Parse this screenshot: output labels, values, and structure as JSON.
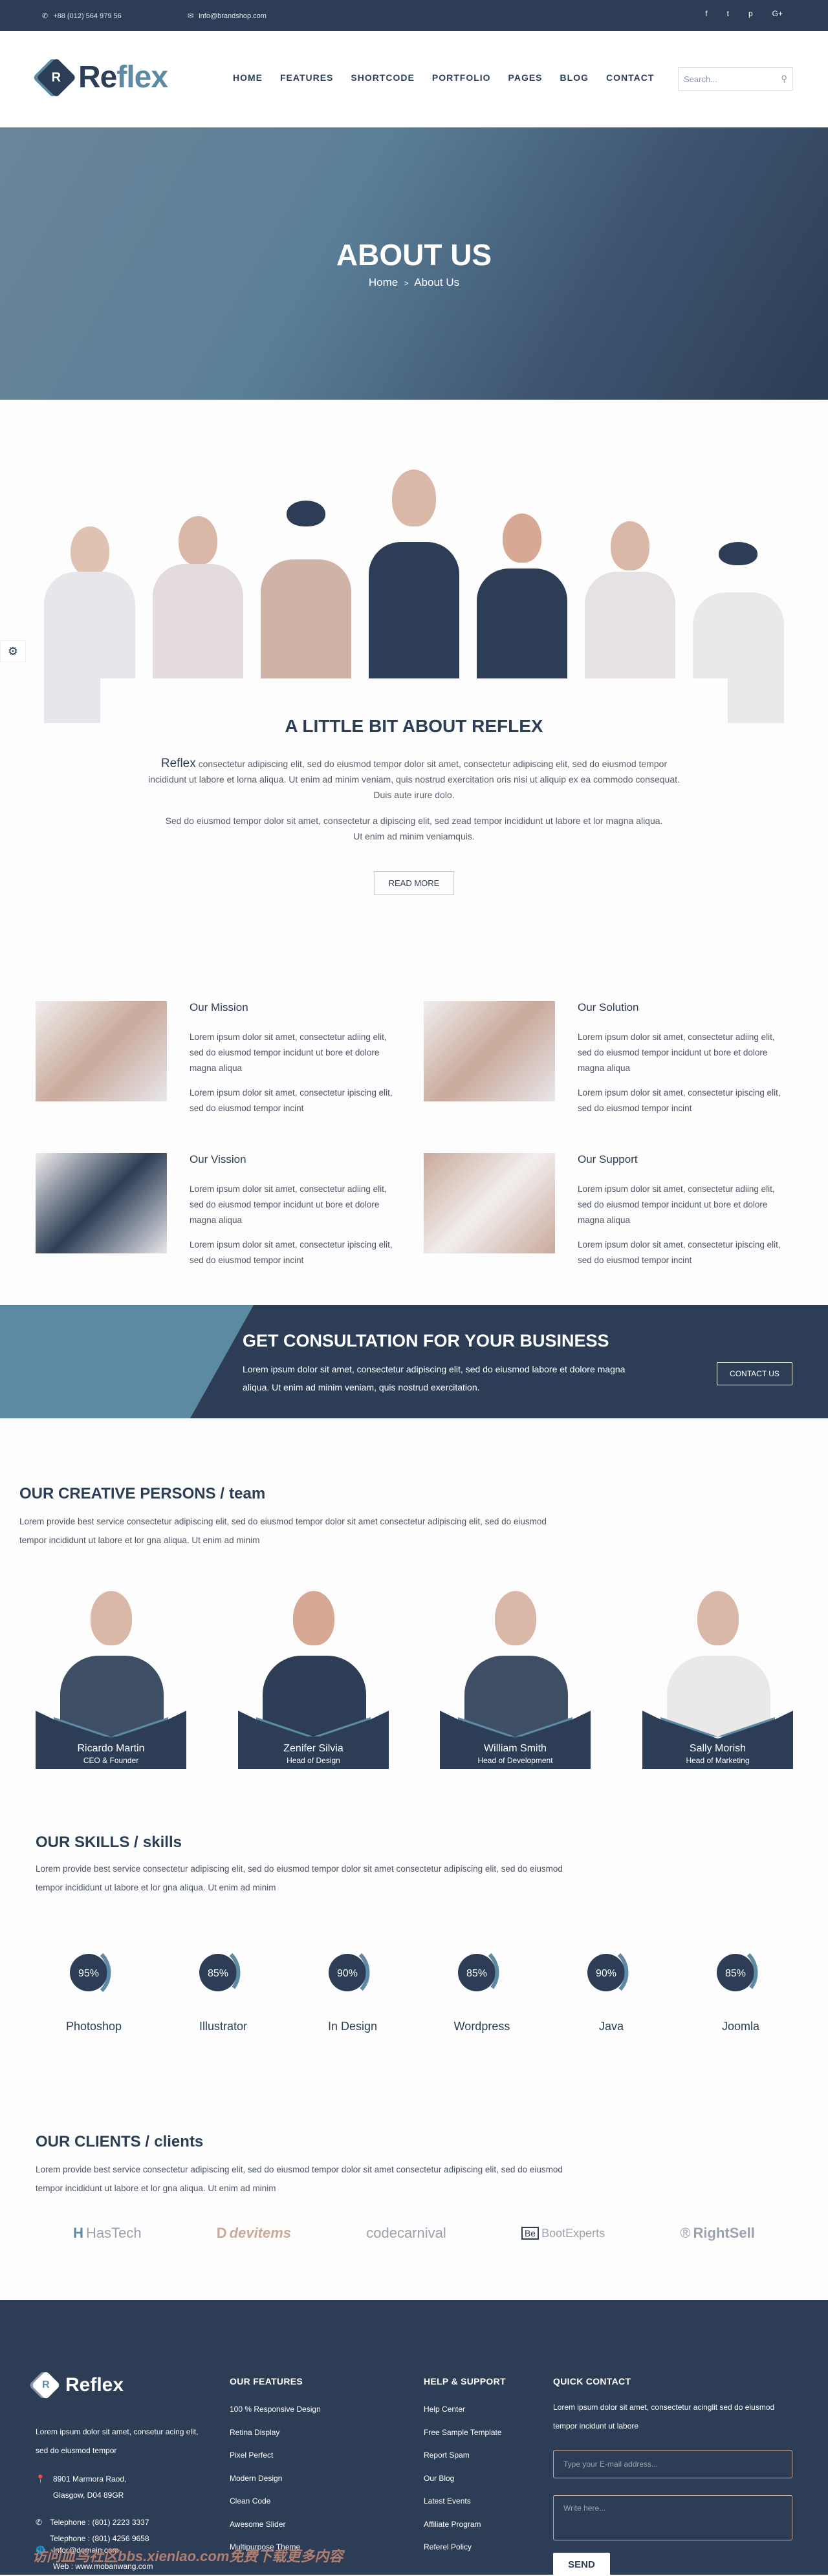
{
  "colors": {
    "primary": "#2c3d55",
    "accent": "#5b8aa2",
    "highlight": "#c9a99a"
  },
  "topbar": {
    "phone": "+88 (012) 564 979 56",
    "email": "info@brandshop.com",
    "phone_icon": "phone-icon",
    "email_icon": "envelope-icon",
    "social": [
      "facebook-icon",
      "twitter-icon",
      "pinterest-icon",
      "google-plus-icon"
    ],
    "social_glyphs": [
      "f",
      "t",
      "p",
      "G+"
    ]
  },
  "header": {
    "logo_letter": "R",
    "logo_part1": "Re",
    "logo_part2": "flex",
    "nav": [
      "HOME",
      "FEATURES",
      "SHORTCODE",
      "PORTFOLIO",
      "PAGES",
      "BLOG",
      "CONTACT"
    ],
    "search_placeholder": "Search..."
  },
  "hero": {
    "title": "ABOUT US",
    "breadcrumb": [
      "Home",
      ">",
      "About Us"
    ]
  },
  "about": {
    "title": "A LITTLE BIT ABOUT REFLEX",
    "brand": "Reflex",
    "p1": "consectetur adipiscing elit, sed do eiusmod tempor dolor sit amet, consectetur adipiscing elit, sed do eiusmod tempor incididunt ut labore et lorna aliqua. Ut enim ad minim veniam, quis nostrud exercitation oris nisi ut aliquip ex ea commodo consequat. Duis aute irure dolo.",
    "p2": "Sed do eiusmod tempor dolor sit amet, consectetur a dipiscing elit, sed zead tempor incididunt ut labore et lor magna aliqua. Ut enim ad minim veniamquis.",
    "button": "READ MORE"
  },
  "features": [
    {
      "title": "Our Mission",
      "p1": "Lorem ipsum dolor sit amet, consectetur adiing elit, sed do eiusmod tempor incidunt ut bore et dolore magna aliqua",
      "p2": "Lorem ipsum dolor sit amet, consectetur ipiscing elit, sed do eiusmod tempor incint"
    },
    {
      "title": "Our Solution",
      "p1": "Lorem ipsum dolor sit amet, consectetur adiing elit, sed do eiusmod tempor incidunt ut bore et dolore magna aliqua",
      "p2": "Lorem ipsum dolor sit amet, consectetur ipiscing elit, sed do eiusmod tempor incint"
    },
    {
      "title": "Our Vission",
      "p1": "Lorem ipsum dolor sit amet, consectetur adiing elit, sed do eiusmod tempor incidunt ut bore et dolore magna aliqua",
      "p2": "Lorem ipsum dolor sit amet, consectetur ipiscing elit, sed do eiusmod tempor incint"
    },
    {
      "title": "Our Support",
      "p1": "Lorem ipsum dolor sit amet, consectetur adiing elit, sed do eiusmod tempor incidunt ut bore et dolore magna aliqua",
      "p2": "Lorem ipsum dolor sit amet, consectetur ipiscing elit, sed do eiusmod tempor incint"
    }
  ],
  "consult": {
    "title": "GET CONSULTATION FOR YOUR BUSINESS",
    "text": "Lorem ipsum dolor sit amet, consectetur adipiscing elit, sed do eiusmod labore et dolore magna aliqua. Ut enim ad minim veniam, quis nostrud exercitation.",
    "button": "CONTACT US"
  },
  "team": {
    "title": "OUR CREATIVE PERSONS /",
    "title_small": "team",
    "text": "Lorem provide best service consectetur adipiscing elit, sed do eiusmod tempor dolor sit amet consectetur adipiscing elit, sed do eiusmod tempor incididunt ut labore et lor gna aliqua. Ut enim ad minim",
    "members": [
      {
        "name": "Ricardo Martin",
        "role": "CEO & Founder"
      },
      {
        "name": "Zenifer Silvia",
        "role": "Head of Design"
      },
      {
        "name": "William Smith",
        "role": "Head of Development"
      },
      {
        "name": "Sally Morish",
        "role": "Head of Marketing"
      }
    ]
  },
  "skills": {
    "title": "OUR SKILLS /",
    "title_small": "skills",
    "text": "Lorem provide best service consectetur adipiscing elit, sed do eiusmod tempor dolor sit amet consectetur adipiscing elit, sed do eiusmod tempor incididunt ut labore et lor gna aliqua. Ut enim ad minim",
    "items": [
      {
        "label": "Photoshop",
        "value": 95,
        "text": "95%"
      },
      {
        "label": "Illustrator",
        "value": 85,
        "text": "85%"
      },
      {
        "label": "In Design",
        "value": 90,
        "text": "90%"
      },
      {
        "label": "Wordpress",
        "value": 85,
        "text": "85%"
      },
      {
        "label": "Java",
        "value": 90,
        "text": "90%"
      },
      {
        "label": "Joomla",
        "value": 85,
        "text": "85%"
      }
    ]
  },
  "clients": {
    "title": "OUR CLIENTS /",
    "title_small": "clients",
    "text": "Lorem provide best service consectetur adipiscing elit, sed do eiusmod tempor dolor sit amet consectetur adipiscing elit, sed do eiusmod tempor incididunt ut labore et lor gna aliqua. Ut enim ad minim",
    "logos": [
      "HasTech",
      "devitems",
      "codecarnival",
      "BootExperts",
      "RightSell"
    ]
  },
  "footer": {
    "logo_letter": "R",
    "logo": "Reflex",
    "about": "Lorem ipsum dolor sit amet, consetur acing elit, sed do eiusmod tempor",
    "address": [
      "8901 Marmora Raod,",
      "Glasgow, D04 89GR"
    ],
    "phones": [
      "Telephone : (801) 2223 3337",
      "Telephone : (801) 4256 9658"
    ],
    "web": [
      "Infor@domain.com",
      "Web : www.mobanwang.com"
    ],
    "features_title": "OUR FEATURES",
    "features": [
      "100 % Responsive Design",
      "Retina Display",
      "Pixel Perfect",
      "Modern Design",
      "Clean Code",
      "Awesome Slider",
      "Multipurpose Theme"
    ],
    "help_title": "HELP & SUPPORT",
    "help": [
      "Help Center",
      "Free Sample Template",
      "Report Spam",
      "Our Blog",
      "Latest Events",
      "Affiliate Program",
      "Referel Policy"
    ],
    "contact_title": "QUICK CONTACT",
    "contact_text": "Lorem ipsum dolor sit amet, consectetur acinglit sed do eiusmod tempor incidunt ut labore",
    "email_placeholder": "Type your E-mail address...",
    "message_placeholder": "Write here...",
    "send": "SEND"
  },
  "watermark": "访问血鸟社区bbs.xienlao.com免费下载更多内容"
}
